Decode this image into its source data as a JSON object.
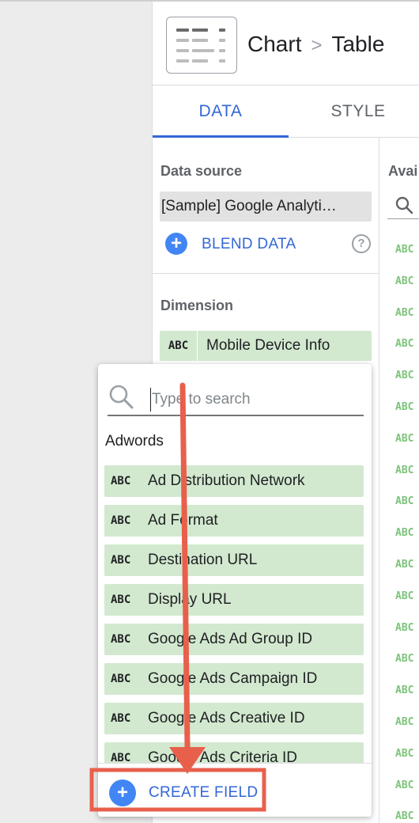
{
  "breadcrumb": {
    "parent": "Chart",
    "separator": ">",
    "current": "Table"
  },
  "tabs": {
    "data": "DATA",
    "style": "STYLE"
  },
  "data_source": {
    "label": "Data source",
    "value": "[Sample] Google Analyti…",
    "blend_label": "BLEND DATA",
    "help_glyph": "?"
  },
  "dimension": {
    "label": "Dimension",
    "type": "ABC",
    "field": "Mobile Device Info"
  },
  "available_fields": {
    "label": "Avai",
    "type_badges": [
      "ABC",
      "ABC",
      "ABC",
      "ABC",
      "ABC",
      "ABC",
      "ABC",
      "ABC",
      "ABC",
      "ABC",
      "ABC",
      "ABC",
      "ABC",
      "ABC",
      "ABC",
      "ABC",
      "ABC",
      "ABC",
      "ABC"
    ]
  },
  "dropdown": {
    "search_placeholder": "Type to search",
    "group_label": "Adwords",
    "fields": [
      {
        "type": "ABC",
        "name": "Ad Distribution Network"
      },
      {
        "type": "ABC",
        "name": "Ad Format"
      },
      {
        "type": "ABC",
        "name": "Destination URL"
      },
      {
        "type": "ABC",
        "name": "Display URL"
      },
      {
        "type": "ABC",
        "name": "Google Ads Ad Group ID"
      },
      {
        "type": "ABC",
        "name": "Google Ads Campaign ID"
      },
      {
        "type": "ABC",
        "name": "Google Ads Creative ID"
      },
      {
        "type": "ABC",
        "name": "Google Ads Criteria ID"
      }
    ],
    "create_field_label": "CREATE FIELD",
    "create_field_glyph": "+"
  },
  "colors": {
    "accent": "#3367d6",
    "add_button": "#4285f4",
    "field_chip": "#d2e9cf",
    "annotation": "#e8604c"
  }
}
